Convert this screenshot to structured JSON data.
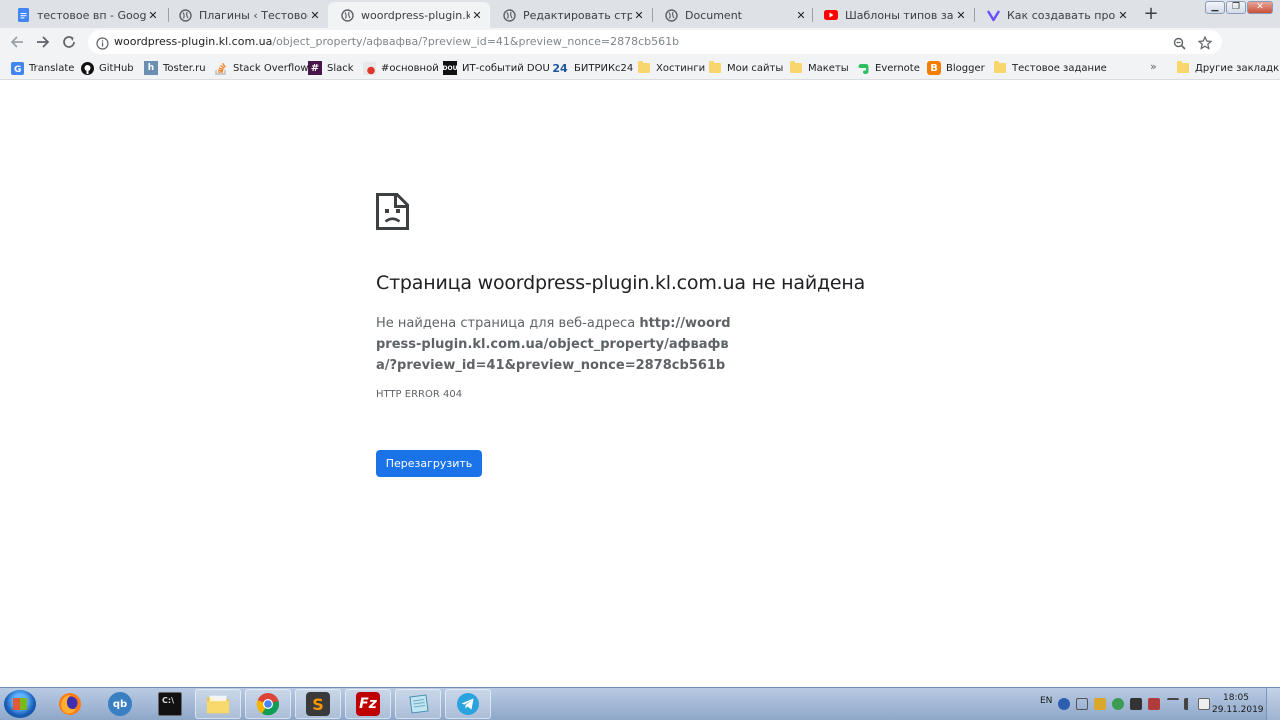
{
  "tabs": [
    {
      "label": "тестовое вп - Google Док",
      "icon": "google-docs-icon",
      "color": "#4285f4"
    },
    {
      "label": "Плагины ‹ Тестовое зада",
      "icon": "globe-icon",
      "color": "#5f6368"
    },
    {
      "label": "woordpress-plugin.kl.com",
      "icon": "globe-icon",
      "color": "#5f6368",
      "active": true
    },
    {
      "label": "Редактировать страницу",
      "icon": "globe-icon",
      "color": "#5f6368"
    },
    {
      "label": "Document",
      "icon": "globe-icon",
      "color": "#5f6368"
    },
    {
      "label": "Шаблоны типов записей",
      "icon": "youtube-icon",
      "color": "#ff0000"
    },
    {
      "label": "Как создавать произволь",
      "icon": "site-icon",
      "color": "#6a4cff"
    }
  ],
  "toolbar": {
    "url_host": "woordpress-plugin.kl.com.ua",
    "url_path": "/object_property/афвафва/?preview_id=41&preview_nonce=2878cb561b"
  },
  "bookmarks": [
    {
      "label": "Translate"
    },
    {
      "label": "GitHub"
    },
    {
      "label": "Toster.ru"
    },
    {
      "label": "Stack Overflow"
    },
    {
      "label": "Slack"
    },
    {
      "label": "#основной"
    },
    {
      "label": "ИТ-событий DOU"
    },
    {
      "label": "БИТРИКс24"
    },
    {
      "label": "Хостинги"
    },
    {
      "label": "Мои сайты"
    },
    {
      "label": "Макеты"
    },
    {
      "label": "Evernote"
    },
    {
      "label": "Blogger"
    },
    {
      "label": "Тестовое задание"
    }
  ],
  "bookmarks_more": "»",
  "other_bookmarks": "Другие закладки",
  "error": {
    "title": "Страница woordpress-plugin.kl.com.ua не найдена",
    "desc_prefix": "Не найдена страница для веб-адреса ",
    "desc_url": "http://woordpress-plugin.kl.com.ua/object_property/афвафва/?preview_id=41&preview_nonce=2878cb561b",
    "code": "HTTP ERROR 404",
    "reload_label": "Перезагрузить"
  },
  "taskbar": {
    "lang": "EN",
    "time": "18:05",
    "date": "29.11.2019",
    "apps": [
      "firefox",
      "qbittorrent",
      "terminal",
      "file-explorer",
      "chrome",
      "sublime-text",
      "filezilla",
      "notepad",
      "telegram"
    ]
  }
}
